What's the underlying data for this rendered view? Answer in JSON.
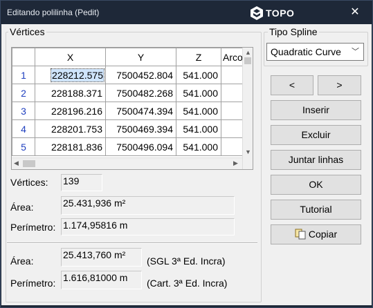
{
  "window": {
    "title": "Editando polilinha  (Pedit)",
    "brand": "TOPO",
    "close_glyph": "✕"
  },
  "vertices_group": {
    "label": "Vértices",
    "columns": [
      "X",
      "Y",
      "Z",
      "Arco"
    ],
    "rows": [
      {
        "n": "1",
        "x": "228212.575",
        "y": "7500452.804",
        "z": "541.000"
      },
      {
        "n": "2",
        "x": "228188.371",
        "y": "7500482.268",
        "z": "541.000"
      },
      {
        "n": "3",
        "x": "228196.216",
        "y": "7500474.394",
        "z": "541.000"
      },
      {
        "n": "4",
        "x": "228201.753",
        "y": "7500469.394",
        "z": "541.000"
      },
      {
        "n": "5",
        "x": "228181.836",
        "y": "7500496.094",
        "z": "541.000"
      }
    ]
  },
  "stats": {
    "vertices_label": "Vértices:",
    "vertices_value": "139",
    "area_label": "Área:",
    "area_value": "25.431,936 m²",
    "perimeter_label": "Perímetro:",
    "perimeter_value": "1.174,95816 m"
  },
  "incra": {
    "area_label": "Área:",
    "area_value": "25.413,760 m²",
    "area_note": "(SGL 3ª Ed. Incra)",
    "perimeter_label": "Perímetro:",
    "perimeter_value": "1.616,81000 m",
    "perimeter_note": "(Cart. 3ª Ed. Incra)"
  },
  "spline": {
    "label": "Tipo Spline",
    "selected": "Quadratic Curve"
  },
  "buttons": {
    "prev": "<",
    "next": ">",
    "insert": "Inserir",
    "delete": "Excluir",
    "join": "Juntar linhas",
    "ok": "OK",
    "tutorial": "Tutorial",
    "copy": "Copiar"
  }
}
